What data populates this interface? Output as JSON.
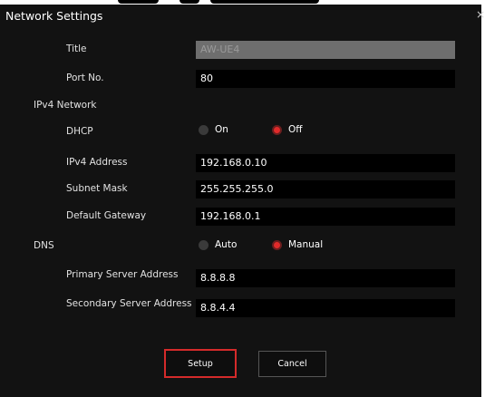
{
  "dialog": {
    "title": "Network Settings",
    "close": "×"
  },
  "fields": {
    "title": {
      "label": "Title",
      "value": "AW-UE4"
    },
    "port": {
      "label": "Port No.",
      "value": "80"
    },
    "ipv4_address": {
      "label": "IPv4 Address",
      "value": "192.168.0.10"
    },
    "subnet_mask": {
      "label": "Subnet Mask",
      "value": "255.255.255.0"
    },
    "default_gateway": {
      "label": "Default Gateway",
      "value": "192.168.0.1"
    },
    "primary_dns": {
      "label": "Primary Server Address",
      "value": "8.8.8.8"
    },
    "secondary_dns": {
      "label": "Secondary Server Address",
      "value": "8.8.4.4"
    }
  },
  "sections": {
    "ipv4": "IPv4 Network",
    "dns": "DNS"
  },
  "dhcp": {
    "label": "DHCP",
    "on": "On",
    "off": "Off",
    "selected": "Off"
  },
  "dns_mode": {
    "auto": "Auto",
    "manual": "Manual",
    "selected": "Manual"
  },
  "buttons": {
    "setup": "Setup",
    "cancel": "Cancel"
  },
  "colors": {
    "accent": "#e02a2a",
    "highlight_border": "#d42a2a",
    "background": "#121212"
  }
}
